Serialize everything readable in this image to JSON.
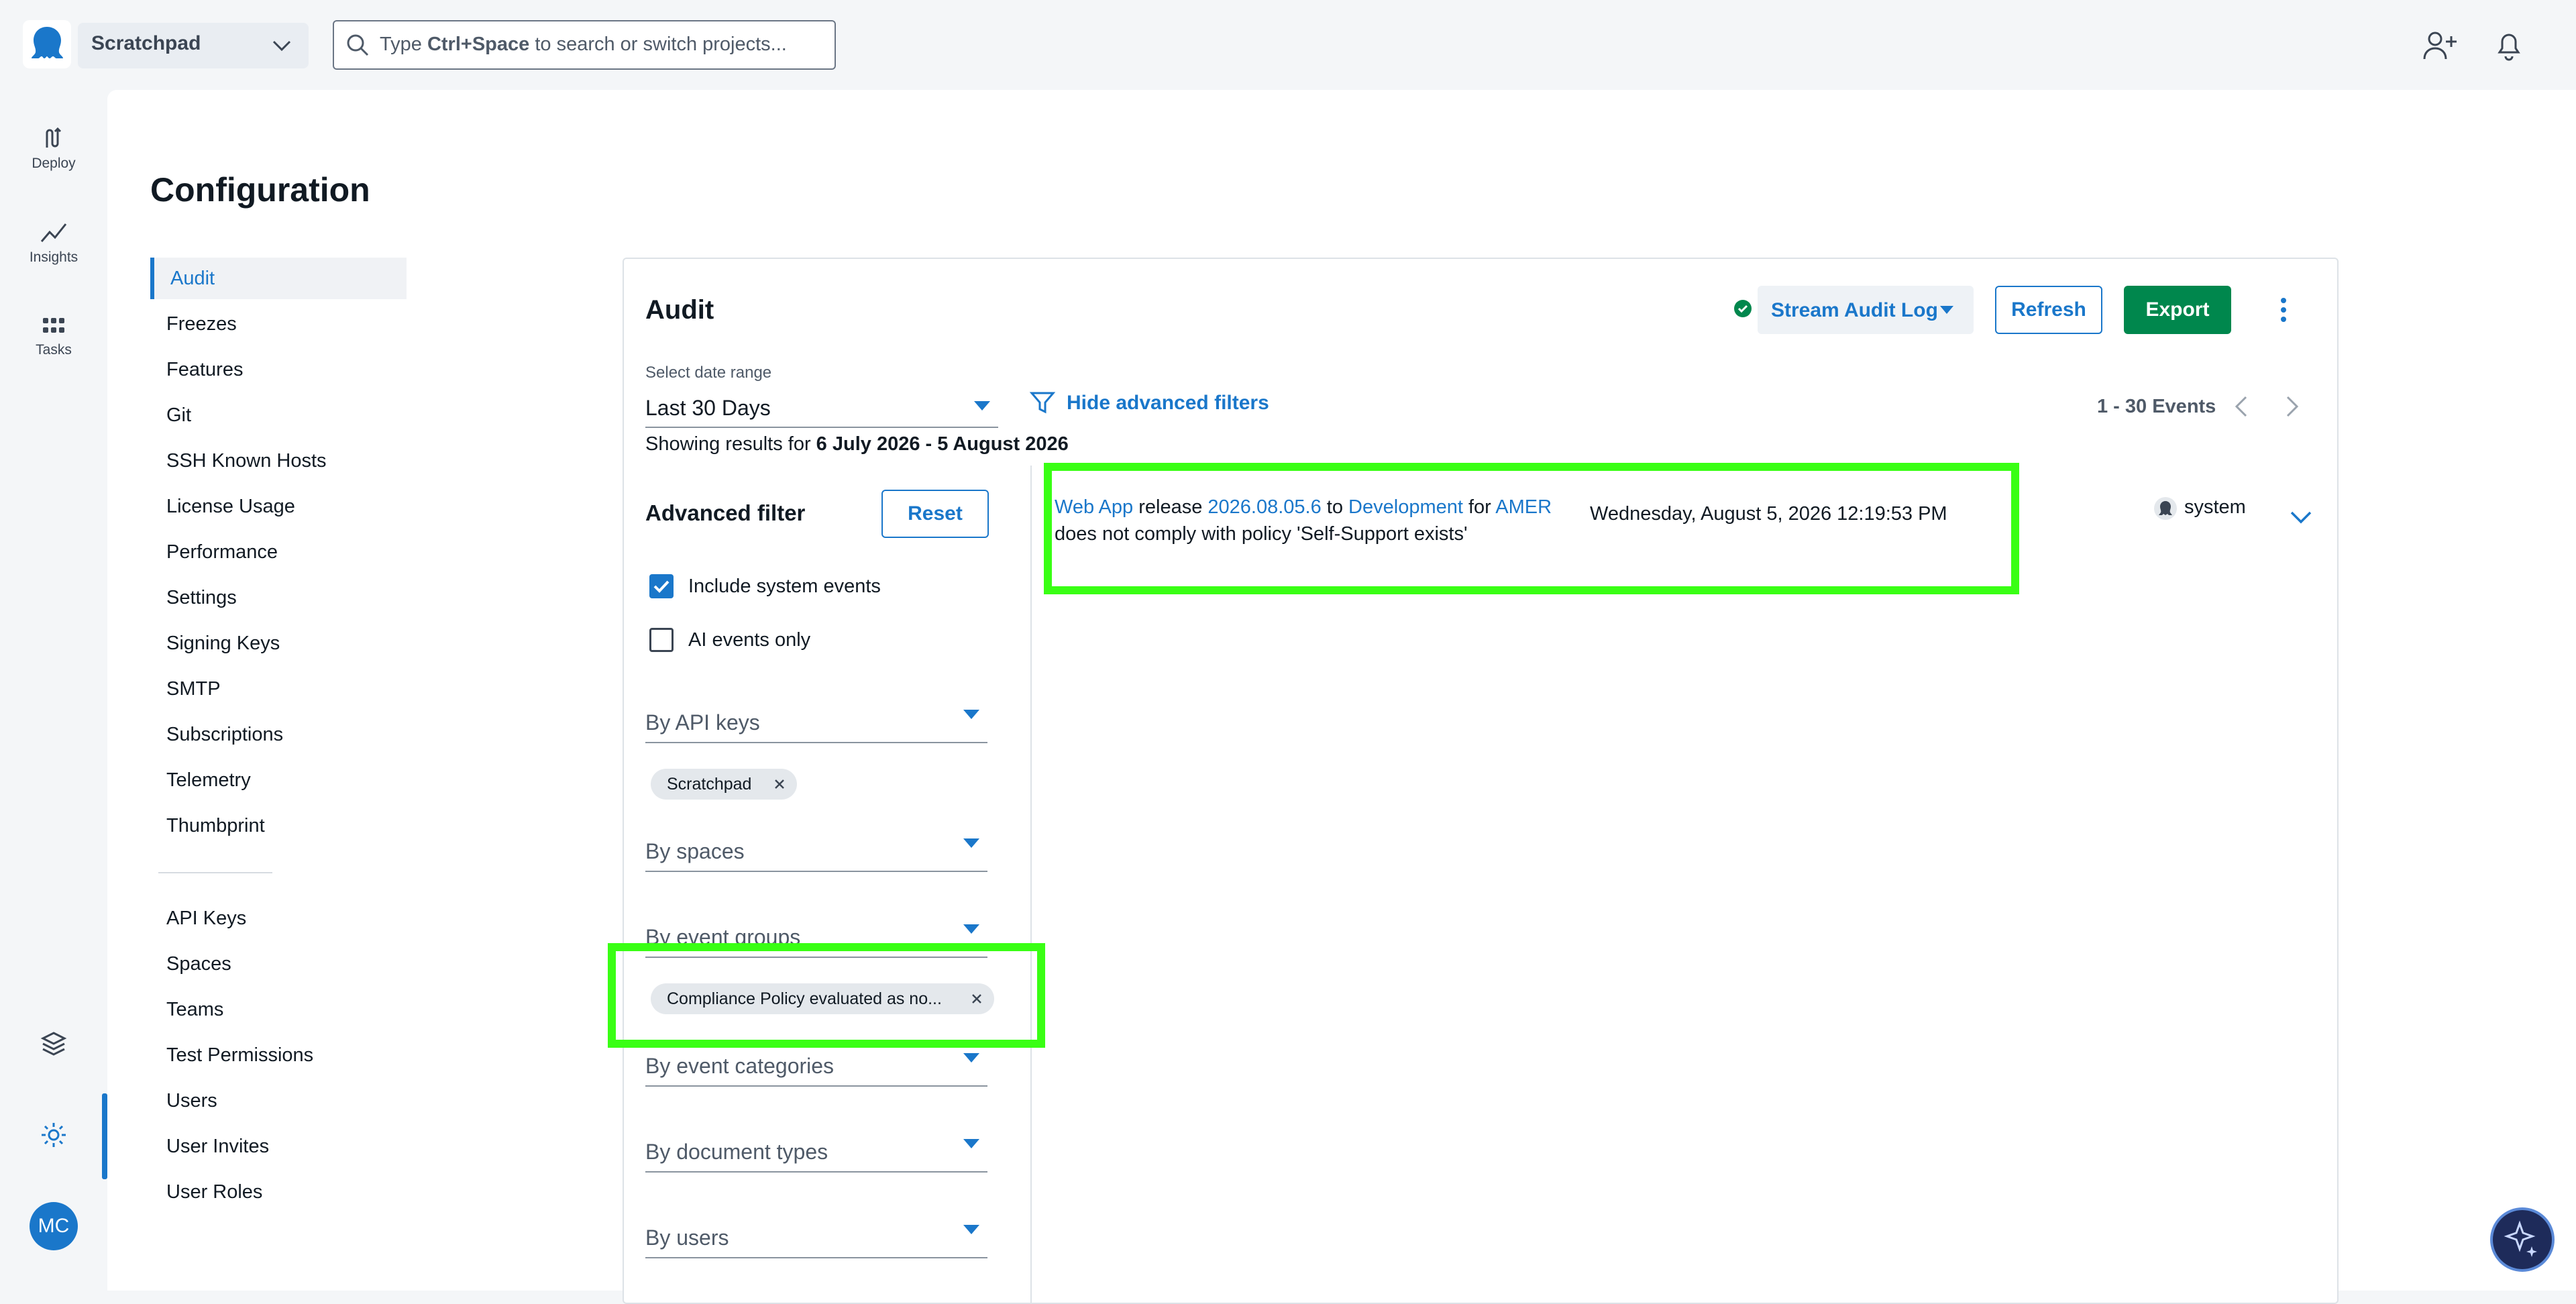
{
  "topbar": {
    "space_name": "Scratchpad",
    "search_placeholder_prefix": "Type ",
    "search_placeholder_bold": "Ctrl+Space",
    "search_placeholder_suffix": " to search or switch projects..."
  },
  "rail": {
    "items": [
      {
        "label": "Deploy",
        "icon": "deploy-icon"
      },
      {
        "label": "Insights",
        "icon": "insights-icon"
      },
      {
        "label": "Tasks",
        "icon": "tasks-icon"
      }
    ],
    "bottom_icons": [
      "layers-icon",
      "settings-gear-icon"
    ],
    "avatar_initials": "MC"
  },
  "page": {
    "title": "Configuration"
  },
  "menu": {
    "group1": [
      "Audit",
      "Freezes",
      "Features",
      "Git",
      "SSH Known Hosts",
      "License Usage",
      "Performance",
      "Settings",
      "Signing Keys",
      "SMTP",
      "Subscriptions",
      "Telemetry",
      "Thumbprint"
    ],
    "group2": [
      "API Keys",
      "Spaces",
      "Teams",
      "Test Permissions",
      "Users",
      "User Invites",
      "User Roles"
    ],
    "active": "Audit"
  },
  "audit": {
    "title": "Audit",
    "stream_label": "Stream Audit Log",
    "refresh_label": "Refresh",
    "export_label": "Export",
    "date_range_label": "Select date range",
    "date_range_value": "Last 30 Days",
    "showing_prefix": "Showing results for ",
    "showing_range": "6 July 2026 - 5 August 2026",
    "hide_filters_label": "Hide advanced filters",
    "events_count": "1 - 30 Events"
  },
  "filters": {
    "title": "Advanced filter",
    "reset_label": "Reset",
    "include_system_events": {
      "label": "Include system events",
      "checked": true
    },
    "ai_events_only": {
      "label": "AI events only",
      "checked": false
    },
    "by_api_keys": "By API keys",
    "api_key_chip": "Scratchpad",
    "by_spaces": "By spaces",
    "by_event_groups": "By event groups",
    "event_group_chip": "Compliance Policy evaluated as no...",
    "by_event_categories": "By event categories",
    "by_document_types": "By document types",
    "by_users": "By users"
  },
  "event": {
    "project": "Web App",
    "w_release": " release ",
    "version": "2026.08.05.6",
    "w_to": " to ",
    "environment": "Development",
    "w_for": " for ",
    "tenant": "AMER",
    "message": "does not comply with policy 'Self-Support exists'",
    "time": "Wednesday, August 5, 2026 12:19:53 PM",
    "user": "system"
  },
  "colors": {
    "accent": "#1a77ca",
    "export_green": "#00874d",
    "highlight": "#39ff14"
  }
}
